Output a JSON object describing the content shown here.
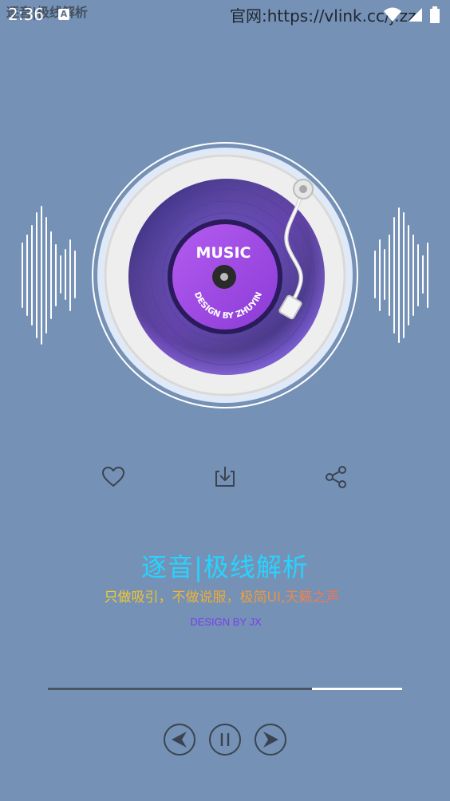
{
  "status_bar": {
    "time": "2:36",
    "app_title": "逐音|极线解析",
    "notification_letter": "A",
    "website_label": "官网:https://vlink.cc/j.zz"
  },
  "turntable": {
    "label_top": "MUSIC",
    "label_bottom": "DESIGN BY ZHUYIN"
  },
  "info": {
    "app_name": "逐音|极线解析",
    "slogan": "只做吸引，不做说服，极简UI,天籁之声",
    "credit": "DESIGN BY JX"
  },
  "player": {
    "progress_fraction": 0.745
  },
  "icons": {
    "like": "heart-icon",
    "download": "download-icon",
    "share": "share-icon",
    "prev": "previous-icon",
    "pause": "pause-icon",
    "next": "next-icon"
  },
  "colors": {
    "background": "#7591b5",
    "title": "#27d3ff",
    "credit": "#7a3cf0",
    "record": "#3b2c8f",
    "label": "#a44be0"
  }
}
